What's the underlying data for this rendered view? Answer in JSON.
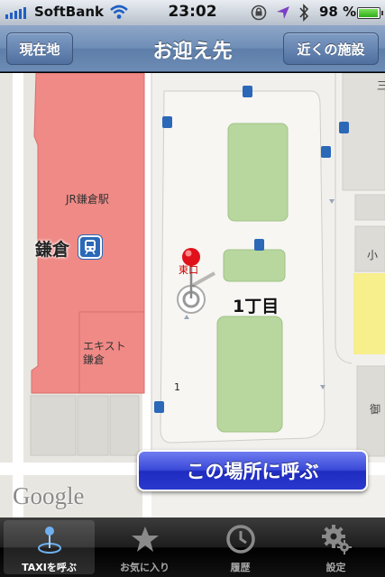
{
  "status_bar": {
    "carrier": "SoftBank",
    "time": "23:02",
    "battery_percent": "98 %",
    "battery_level": 0.98,
    "icons": [
      "signal-icon",
      "wifi-icon",
      "rotation-lock-icon",
      "location-arrow-icon",
      "bluetooth-icon",
      "battery-icon"
    ]
  },
  "nav": {
    "left_button": "現在地",
    "title": "お迎え先",
    "right_button": "近くの施設"
  },
  "map": {
    "labels": {
      "station_name": "JR鎌倉駅",
      "kamakura": "鎌倉",
      "ekisuto": "エキスト 鎌倉",
      "block": "1丁目",
      "number_one": "1",
      "higashi": "東口",
      "ko": "小",
      "go": "御",
      "right_text": "三"
    },
    "google": "Google",
    "colors": {
      "station_area": "#f08a86",
      "park": "#b8d79e",
      "road": "#ffffff",
      "pin": "#e0111b"
    }
  },
  "call_button": "この場所に呼ぶ",
  "tabs": [
    {
      "label": "TAXIを呼ぶ",
      "icon": "taxi-pin-icon",
      "active": true
    },
    {
      "label": "お気に入り",
      "icon": "star-icon",
      "active": false
    },
    {
      "label": "履歴",
      "icon": "clock-icon",
      "active": false
    },
    {
      "label": "設定",
      "icon": "gear-icon",
      "active": false
    }
  ]
}
